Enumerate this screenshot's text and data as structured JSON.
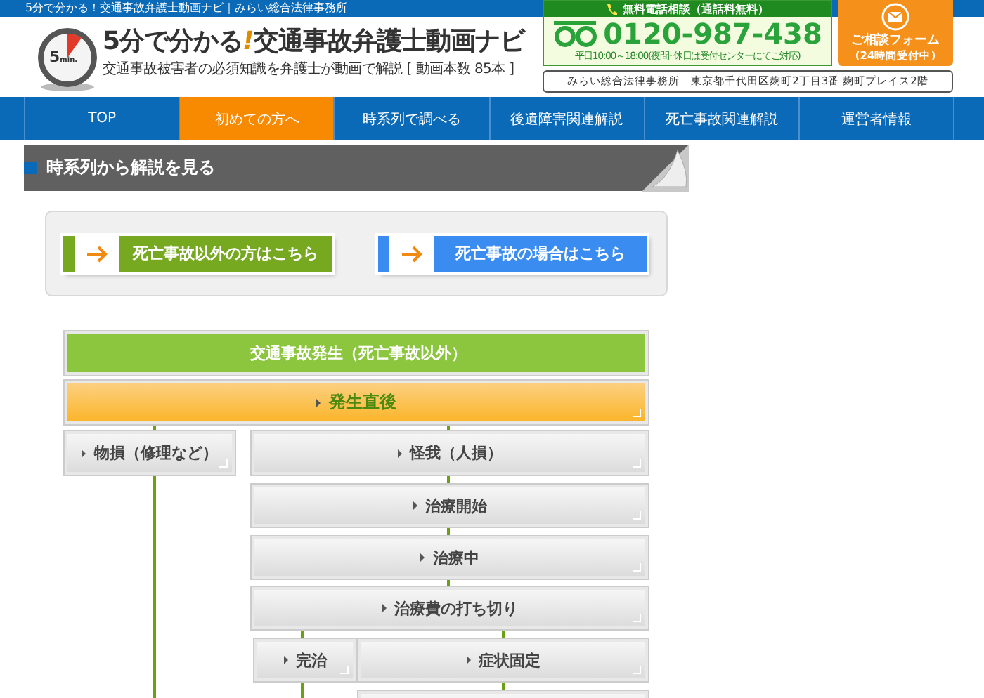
{
  "top_strip": {
    "text": "5分で分かる！交通事故弁護士動画ナビ｜みらい総合法律事務所"
  },
  "header": {
    "title": "5分で分かる",
    "title_mark": "!",
    "title_rest": "交通事故弁護士動画ナビ",
    "subtitle": "交通事故被害者の必須知識を弁護士が動画で解説 [ 動画本数 85本 ]",
    "clock_label": "5",
    "clock_unit": "min.",
    "phone": {
      "heading": "無料電話相談（通話料無料）",
      "number": "0120-987-438",
      "hours": "平日10:00～18:00(夜間･休日は受付センターにてご対応)"
    },
    "form": {
      "line1": "ご相談フォーム",
      "line2": "(24時間受付中)"
    },
    "address": "みらい総合法律事務所｜東京都千代田区麹町2丁目3番 麹町プレイス2階"
  },
  "nav": [
    {
      "label": "TOP",
      "selected": false
    },
    {
      "label": "初めての方へ",
      "selected": true
    },
    {
      "label": "時系列で調べる",
      "selected": false
    },
    {
      "label": "後遺障害関連解説",
      "selected": false
    },
    {
      "label": "死亡事故関連解説",
      "selected": false
    },
    {
      "label": "運営者情報",
      "selected": false
    }
  ],
  "section_title": "時系列から解説を見る",
  "choice_buttons": [
    {
      "label": "死亡事故以外の方はこちら",
      "color": "#76a820"
    },
    {
      "label": "死亡事故の場合はこちら",
      "color": "#3a8cf0"
    }
  ],
  "flow_nodes": [
    {
      "kind": "header",
      "label": "交通事故発生（死亡事故以外）"
    },
    {
      "kind": "current",
      "label": "発生直後"
    },
    {
      "kind": "step",
      "label": "物損（修理など）"
    },
    {
      "kind": "step",
      "label": "怪我（人損）"
    },
    {
      "kind": "step",
      "label": "治療開始"
    },
    {
      "kind": "step",
      "label": "治療中"
    },
    {
      "kind": "step",
      "label": "治療費の打ち切り"
    },
    {
      "kind": "step",
      "label": "完治"
    },
    {
      "kind": "step",
      "label": "症状固定"
    },
    {
      "kind": "step"
    }
  ]
}
